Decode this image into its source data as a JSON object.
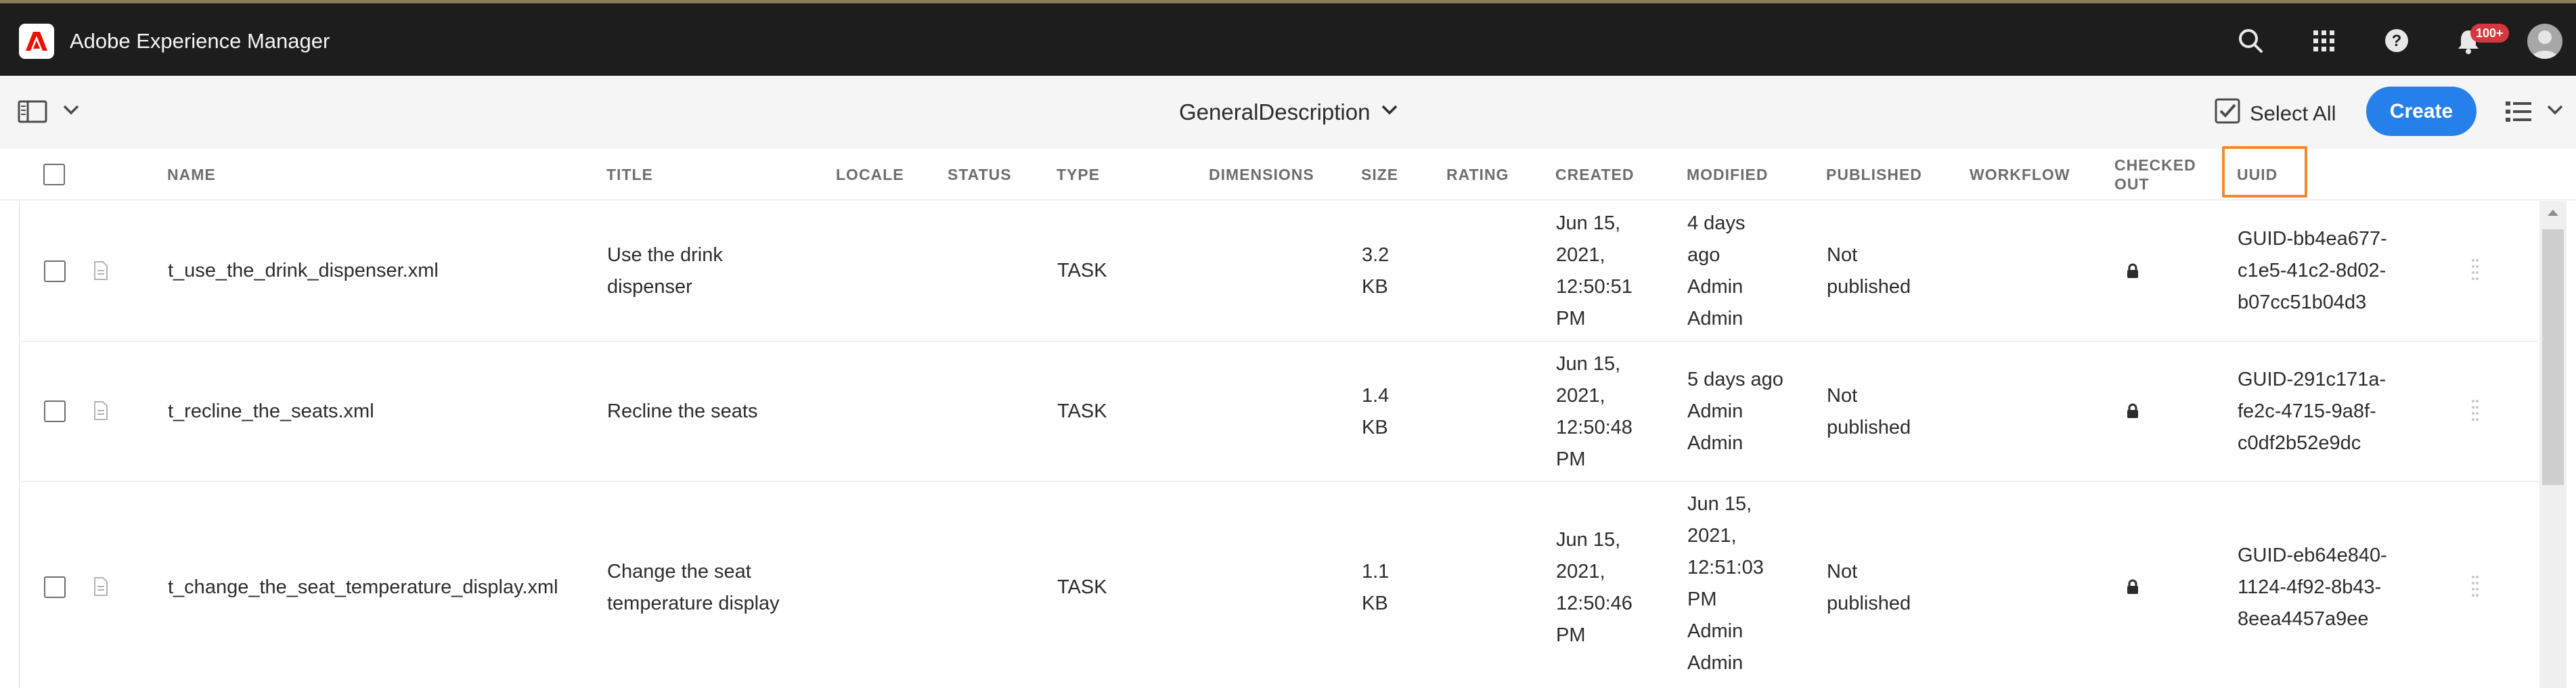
{
  "app": {
    "title": "Adobe Experience Manager",
    "notification_count": "100+",
    "icons": [
      "search-icon",
      "apps-grid-icon",
      "help-icon",
      "bell-icon",
      "avatar"
    ]
  },
  "actionbar": {
    "folder_title": "GeneralDescription",
    "select_all_label": "Select All",
    "create_label": "Create",
    "create_color": "#2680eb"
  },
  "columns": {
    "name": "NAME",
    "title": "TITLE",
    "locale": "LOCALE",
    "status": "STATUS",
    "type": "TYPE",
    "dimensions": "DIMENSIONS",
    "size": "SIZE",
    "rating": "RATING",
    "created": "CREATED",
    "modified": "MODIFIED",
    "published": "PUBLISHED",
    "workflow": "WORKFLOW",
    "checked_out_1": "CHECKED",
    "checked_out_2": "OUT",
    "uuid": "UUID"
  },
  "highlight_color": "#f0892e",
  "rows": [
    {
      "name": "t_use_the_drink_dispenser.xml",
      "title": [
        "Use the drink",
        "dispenser"
      ],
      "type": "TASK",
      "size": [
        "3.2",
        "KB"
      ],
      "created": [
        "Jun 15,",
        "2021,",
        "12:50:51",
        "PM"
      ],
      "modified": [
        "4 days",
        "ago",
        "Admin",
        "Admin"
      ],
      "published": [
        "Not",
        "published"
      ],
      "checked_out": "lock-icon",
      "uuid": [
        "GUID-bb4ea677-",
        "c1e5-41c2-8d02-",
        "b07cc51b04d3"
      ]
    },
    {
      "name": "t_recline_the_seats.xml",
      "title": [
        "Recline the seats"
      ],
      "type": "TASK",
      "size": [
        "1.4",
        "KB"
      ],
      "created": [
        "Jun 15,",
        "2021,",
        "12:50:48",
        "PM"
      ],
      "modified": [
        "5 days ago",
        "Admin",
        "Admin"
      ],
      "published": [
        "Not",
        "published"
      ],
      "checked_out": "lock-icon",
      "uuid": [
        "GUID-291c171a-",
        "fe2c-4715-9a8f-",
        "c0df2b52e9dc"
      ]
    },
    {
      "name": "t_change_the_seat_temperature_display.xml",
      "title": [
        "Change the seat",
        "temperature display"
      ],
      "type": "TASK",
      "size": [
        "1.1",
        "KB"
      ],
      "created": [
        "Jun 15,",
        "2021,",
        "12:50:46",
        "PM"
      ],
      "modified": [
        "Jun 15,",
        "2021,",
        "12:51:03",
        "PM",
        "Admin",
        "Admin"
      ],
      "published": [
        "Not",
        "published"
      ],
      "checked_out": "lock-icon",
      "uuid": [
        "GUID-eb64e840-",
        "1124-4f92-8b43-",
        "8eea4457a9ee"
      ]
    }
  ]
}
